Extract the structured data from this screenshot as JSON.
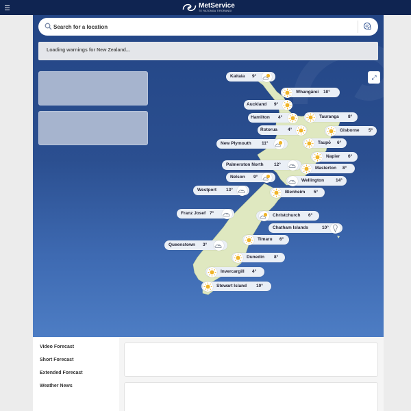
{
  "header": {
    "brand": "MetService",
    "tagline": "TE RATONGA TIRORANGI",
    "menu_icon": "hamburger-icon",
    "logo_icon": "metservice-swirl-logo"
  },
  "search": {
    "placeholder": "Search for a location",
    "icon": "search-icon",
    "locate_icon": "location-search-icon"
  },
  "warnings": {
    "text": "Loading warnings for New Zealand..."
  },
  "map": {
    "expand_icon": "expand-icon",
    "expand_glyph": "⤢",
    "colors": {
      "land": "#dfe8c0",
      "sea_top": "#234585",
      "sea_bottom": "#4d7dc4",
      "pill": "#eaeff6",
      "sun": "#f0b429"
    },
    "locations": [
      {
        "name": "Kaitaia",
        "temp": "9°",
        "icon": "partly-cloudy-icon"
      },
      {
        "name": "Whangārei",
        "temp": "10°",
        "icon": "sunny-icon"
      },
      {
        "name": "Auckland",
        "temp": "9°",
        "icon": "sunny-icon"
      },
      {
        "name": "Hamilton",
        "temp": "4°",
        "icon": "sunny-icon"
      },
      {
        "name": "Tauranga",
        "temp": "8°",
        "icon": "sunny-icon"
      },
      {
        "name": "Rotorua",
        "temp": "4°",
        "icon": "sunny-icon"
      },
      {
        "name": "Gisborne",
        "temp": "5°",
        "icon": "sunny-icon"
      },
      {
        "name": "New Plymouth",
        "temp": "11°",
        "icon": "partly-cloudy-icon"
      },
      {
        "name": "Taupō",
        "temp": "6°",
        "icon": "sunny-icon"
      },
      {
        "name": "Napier",
        "temp": "6°",
        "icon": "sunny-icon"
      },
      {
        "name": "Palmerston North",
        "temp": "12°",
        "icon": "cloudy-icon"
      },
      {
        "name": "Masterton",
        "temp": "8°",
        "icon": "sunny-icon"
      },
      {
        "name": "Nelson",
        "temp": "9°",
        "icon": "partly-cloudy-icon"
      },
      {
        "name": "Wellington",
        "temp": "14°",
        "icon": "cloudy-icon"
      },
      {
        "name": "Westport",
        "temp": "13°",
        "icon": "cloudy-icon"
      },
      {
        "name": "Blenheim",
        "temp": "5°",
        "icon": "sunny-icon"
      },
      {
        "name": "Franz Josef",
        "temp": "7°",
        "icon": "cloudy-icon"
      },
      {
        "name": "Christchurch",
        "temp": "6°",
        "icon": "partly-cloudy-icon"
      },
      {
        "name": "Chatham Islands",
        "temp": "10°",
        "icon": "showers-icon"
      },
      {
        "name": "Timaru",
        "temp": "6°",
        "icon": "sunny-icon"
      },
      {
        "name": "Queenstown",
        "temp": "3°",
        "icon": "cloudy-icon"
      },
      {
        "name": "Dunedin",
        "temp": "8°",
        "icon": "sunny-icon"
      },
      {
        "name": "Invercargill",
        "temp": "4°",
        "icon": "sunny-icon"
      },
      {
        "name": "Stewart Island",
        "temp": "10°",
        "icon": "sunny-icon"
      }
    ]
  },
  "nav": {
    "items": [
      {
        "label": "Video Forecast"
      },
      {
        "label": "Short Forecast"
      },
      {
        "label": "Extended Forecast"
      },
      {
        "label": "Weather News"
      }
    ]
  }
}
